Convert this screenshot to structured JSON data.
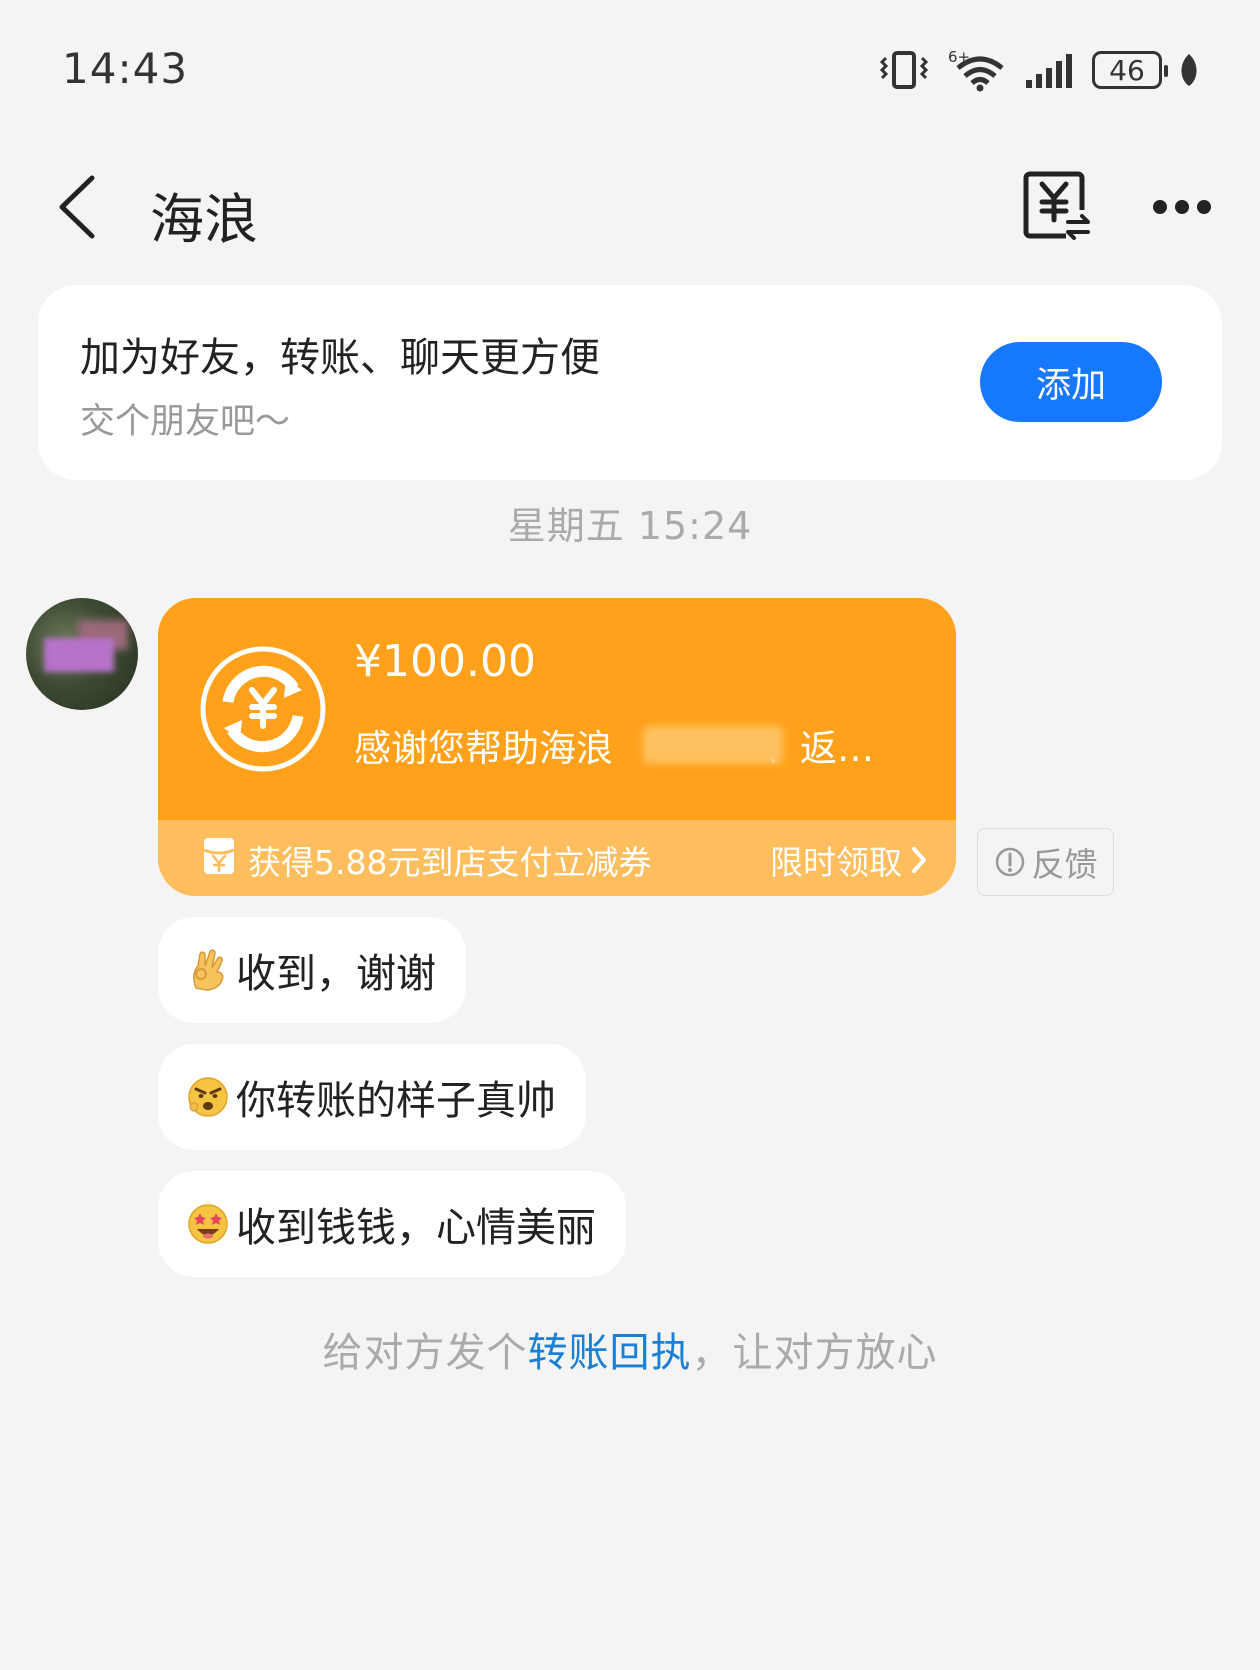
{
  "status_bar": {
    "time": "14:43",
    "battery": "46",
    "wifi_badge": "6+"
  },
  "header": {
    "title": "海浪"
  },
  "friend_card": {
    "title": "加为好友，转账、聊天更方便",
    "subtitle": "交个朋友吧～",
    "add_label": "添加"
  },
  "timestamp": "星期五 15:24",
  "transfer": {
    "amount": "¥100.00",
    "remark": "感谢您帮助海浪",
    "remark_suffix": "、返…",
    "coupon_text": "获得5.88元到店支付立减券",
    "coupon_cta": "限时领取",
    "feedback_label": "反馈",
    "colors": {
      "primary": "#ffa11b",
      "secondary": "#ffbe5d"
    }
  },
  "messages": [
    {
      "emoji": "ok-hand-emoji",
      "text": "收到，谢谢"
    },
    {
      "emoji": "angry-face-emoji",
      "text": "你转账的样子真帅"
    },
    {
      "emoji": "star-struck-face-emoji",
      "text": "收到钱钱，心情美丽"
    }
  ],
  "footer": {
    "prefix": "给对方发个",
    "link": "转账回执",
    "suffix": "，让对方放心"
  },
  "colors": {
    "accent": "#1677ff",
    "link": "#1a7fd6",
    "background": "#f4f4f4"
  }
}
